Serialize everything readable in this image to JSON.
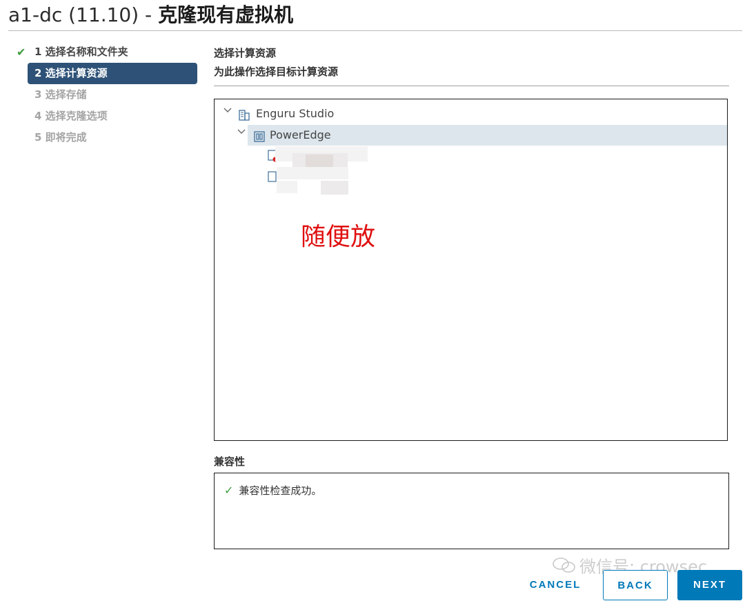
{
  "window": {
    "title_prefix": "a1-dc (11.10) - ",
    "title_main": "克隆现有虚拟机"
  },
  "steps": [
    {
      "number": "1",
      "label": "选择名称和文件夹",
      "state": "done"
    },
    {
      "number": "2",
      "label": "选择计算资源",
      "state": "active"
    },
    {
      "number": "3",
      "label": "选择存储",
      "state": "pending"
    },
    {
      "number": "4",
      "label": "选择克隆选项",
      "state": "pending"
    },
    {
      "number": "5",
      "label": "即将完成",
      "state": "pending"
    }
  ],
  "step_labels": {
    "s1": "1 选择名称和文件夹",
    "s2": "2 选择计算资源",
    "s3": "3 选择存储",
    "s4": "4 选择克隆选项",
    "s5": "5 即将完成"
  },
  "section": {
    "title": "选择计算资源",
    "subtitle": "为此操作选择目标计算资源"
  },
  "tree": {
    "root_label": "Enguru Studio",
    "root_icon": "datacenter-icon",
    "cluster_label": "PowerEdge",
    "cluster_icon": "cluster-icon",
    "cluster_selected": true,
    "child_icons": [
      "host-warning-icon",
      "host-icon"
    ]
  },
  "annotation": {
    "text": "随便放",
    "color": "#e01010"
  },
  "compatibility": {
    "label": "兼容性",
    "message": "兼容性检查成功。"
  },
  "watermark": {
    "text": "微信号: crowsec"
  },
  "buttons": {
    "cancel": "CANCEL",
    "back": "BACK",
    "next": "NEXT"
  },
  "colors": {
    "accent": "#0079b8",
    "active_step": "#2e5277",
    "success": "#3c9c3c",
    "selected_row": "#dde6ed"
  }
}
